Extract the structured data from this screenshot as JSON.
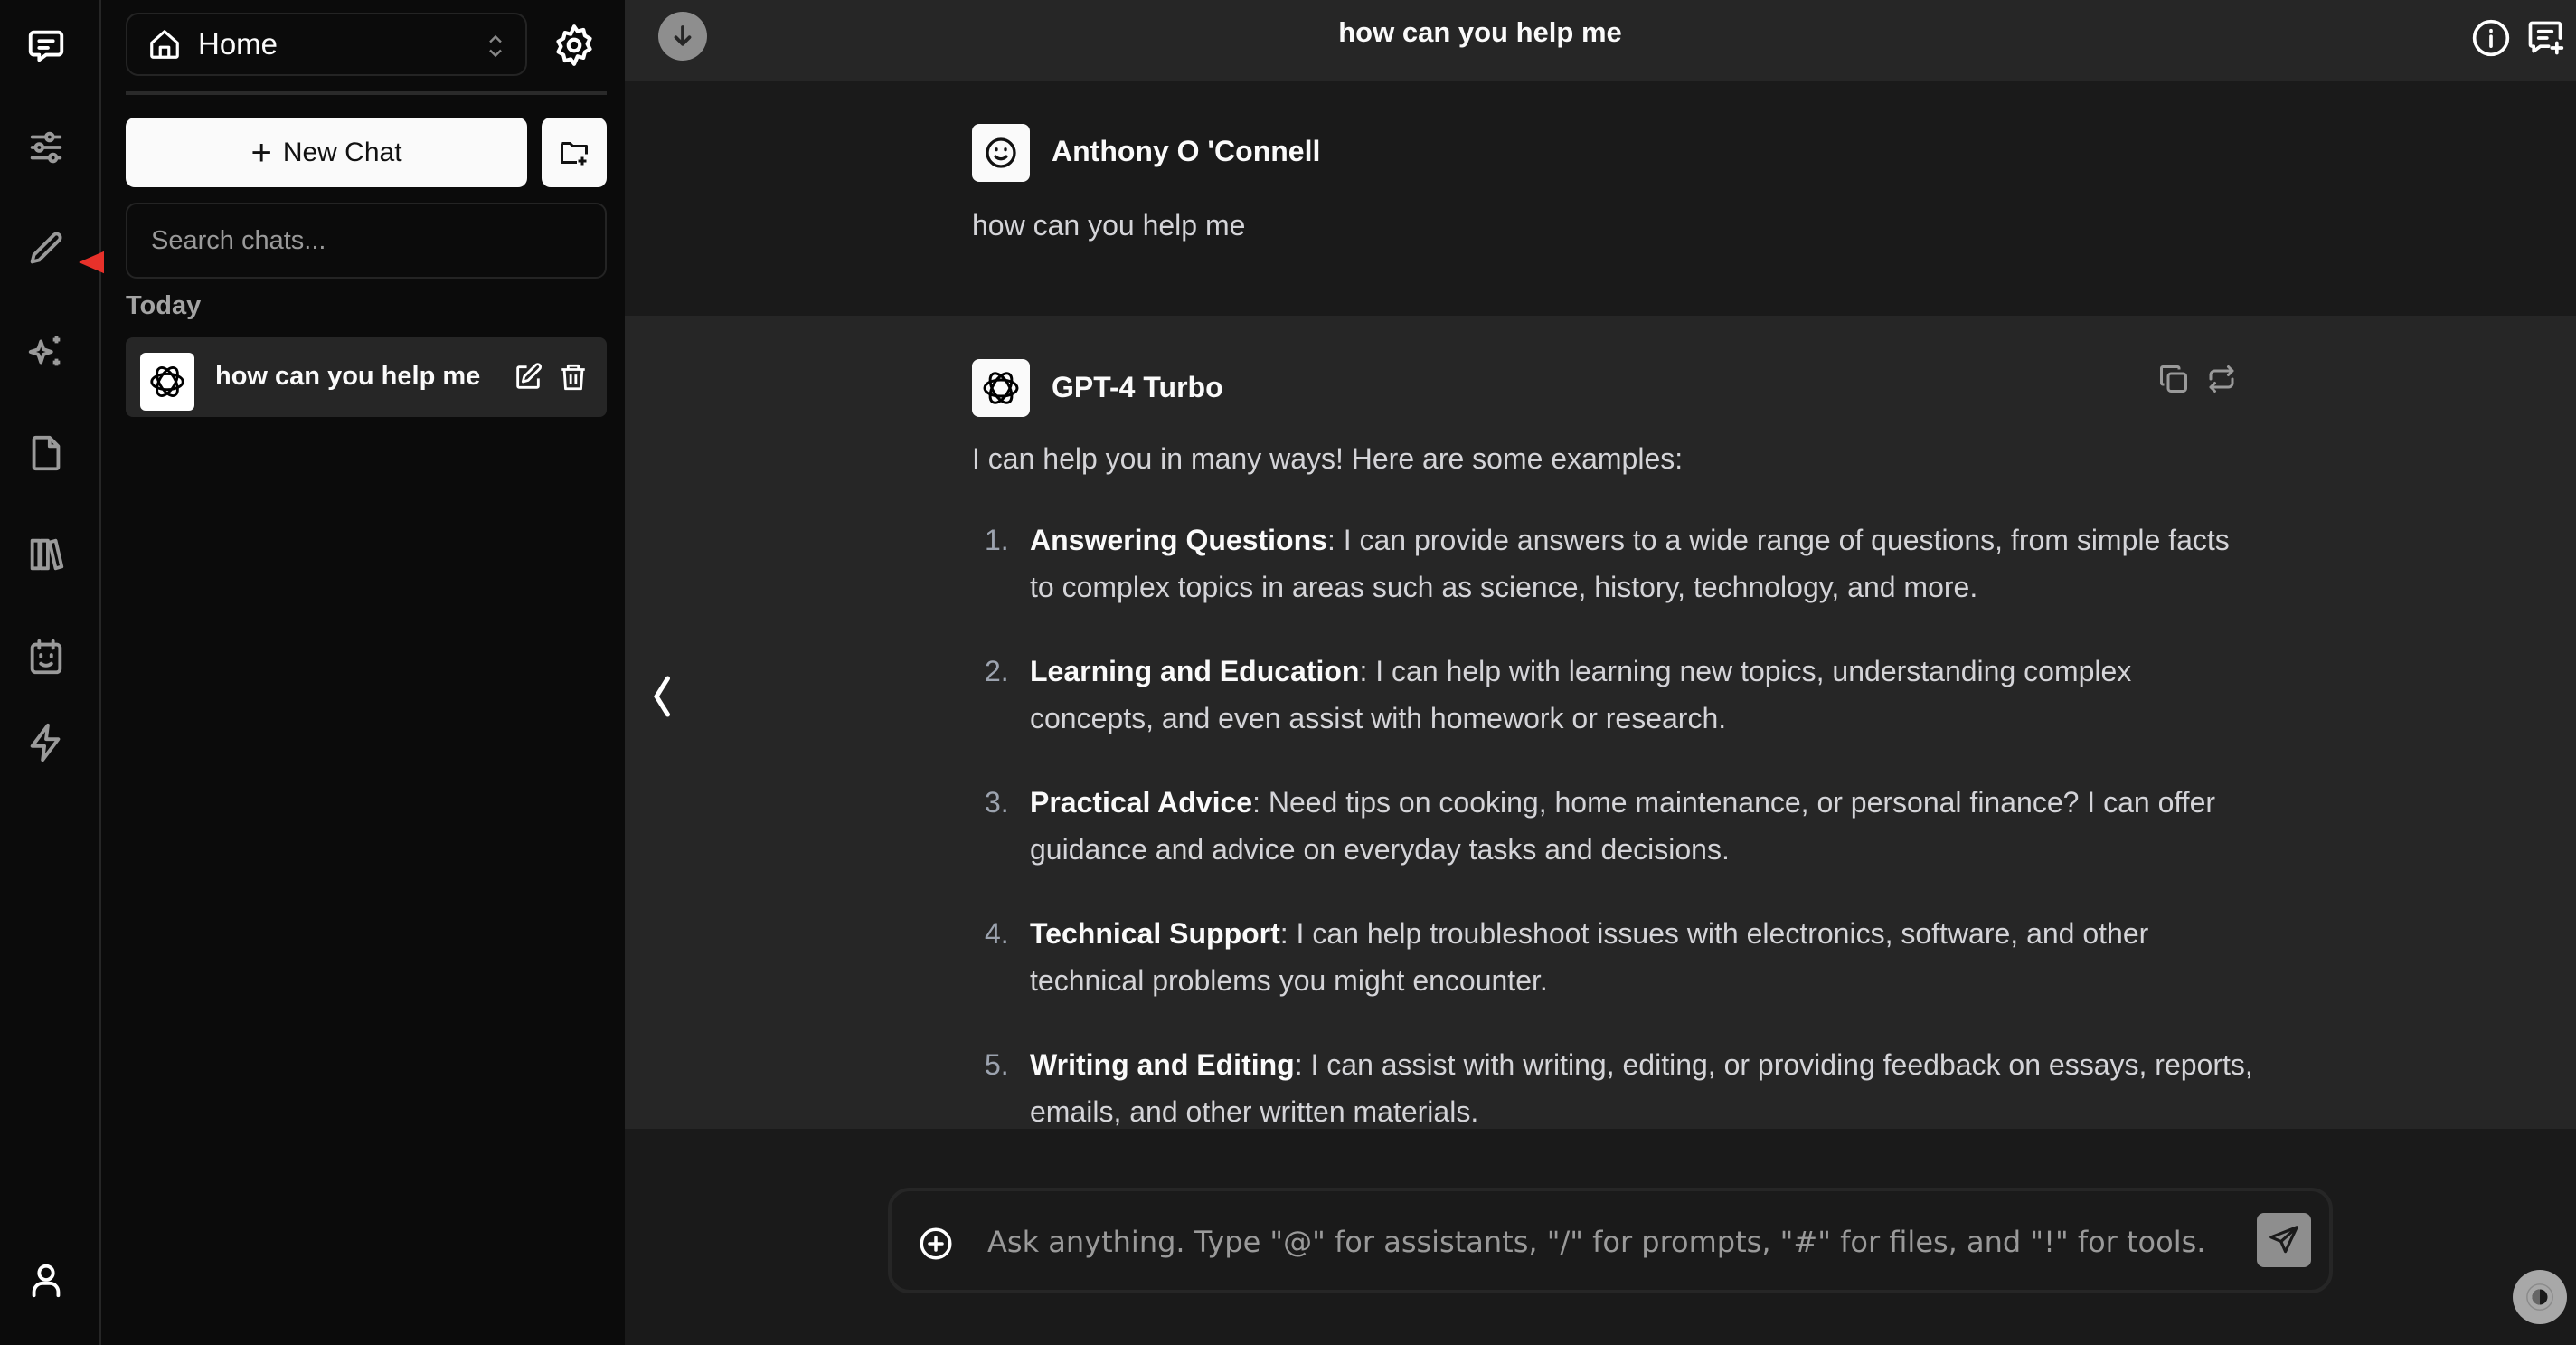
{
  "rail": {
    "items": [
      {
        "name": "chat-icon",
        "active": true
      },
      {
        "name": "sliders-icon",
        "active": false
      },
      {
        "name": "pencil-icon",
        "active": false
      },
      {
        "name": "sparkles-icon",
        "active": false
      },
      {
        "name": "file-icon",
        "active": false
      },
      {
        "name": "books-icon",
        "active": false
      },
      {
        "name": "calendar-smile-icon",
        "active": false
      },
      {
        "name": "lightning-icon",
        "active": false
      }
    ],
    "bottom": {
      "name": "user-icon"
    }
  },
  "sidebar": {
    "workspace_select": "Home",
    "new_chat_label": "New Chat",
    "search_placeholder": "Search chats...",
    "section_label": "Today",
    "chats": [
      {
        "title": "how can you help me",
        "avatar": "openai-logo-icon",
        "selected": true
      }
    ]
  },
  "header": {
    "title": "how can you help me"
  },
  "messages": [
    {
      "role": "user",
      "author": "Anthony O 'Connell",
      "avatar": "smiley-icon",
      "text": "how can you help me"
    },
    {
      "role": "assistant",
      "author": "GPT-4 Turbo",
      "avatar": "openai-logo-icon",
      "intro": "I can help you in many ways! Here are some examples:",
      "items": [
        {
          "num": "1.",
          "title": "Answering Questions",
          "text": ": I can provide answers to a wide range of questions, from simple facts to complex topics in areas such as science, history, technology, and more."
        },
        {
          "num": "2.",
          "title": "Learning and Education",
          "text": ": I can help with learning new topics, understanding complex concepts, and even assist with homework or research."
        },
        {
          "num": "3.",
          "title": "Practical Advice",
          "text": ": Need tips on cooking, home maintenance, or personal finance? I can offer guidance and advice on everyday tasks and decisions."
        },
        {
          "num": "4.",
          "title": "Technical Support",
          "text": ": I can help troubleshoot issues with electronics, software, and other technical problems you might encounter."
        },
        {
          "num": "5.",
          "title": "Writing and Editing",
          "text": ": I can assist with writing, editing, or providing feedback on essays, reports, emails, and other written materials."
        }
      ]
    }
  ],
  "composer": {
    "placeholder": "Ask anything. Type \"@\" for assistants, \"/\" for prompts, \"#\" for files, and \"!\" for tools.",
    "value": ""
  },
  "colors": {
    "annotation_arrow": "#e8312a",
    "accent_light": "#fafafa"
  }
}
